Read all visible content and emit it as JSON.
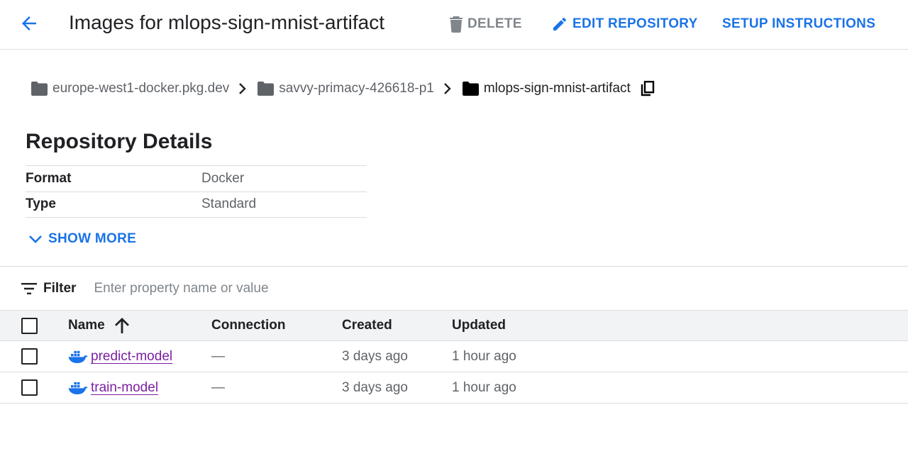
{
  "header": {
    "title": "Images for mlops-sign-mnist-artifact",
    "delete_label": "DELETE",
    "edit_label": "EDIT REPOSITORY",
    "setup_label": "SETUP INSTRUCTIONS"
  },
  "breadcrumb": {
    "items": [
      "europe-west1-docker.pkg.dev",
      "savvy-primacy-426618-p1",
      "mlops-sign-mnist-artifact"
    ]
  },
  "details": {
    "title": "Repository Details",
    "rows": [
      {
        "key": "Format",
        "value": "Docker"
      },
      {
        "key": "Type",
        "value": "Standard"
      }
    ],
    "show_more_label": "SHOW MORE"
  },
  "filter": {
    "label": "Filter",
    "placeholder": "Enter property name or value"
  },
  "table": {
    "columns": [
      "Name",
      "Connection",
      "Created",
      "Updated"
    ],
    "sort_column": "Name",
    "sort_direction": "ascending",
    "rows": [
      {
        "name": "predict-model",
        "connection": "—",
        "created": "3 days ago",
        "updated": "1 hour ago"
      },
      {
        "name": "train-model",
        "connection": "—",
        "created": "3 days ago",
        "updated": "1 hour ago"
      }
    ]
  },
  "icons": [
    "back-arrow-icon",
    "trash-icon",
    "pencil-icon",
    "folder-icon",
    "chevron-right-icon",
    "copy-icon",
    "chevron-down-icon",
    "filter-icon",
    "arrow-up-icon",
    "docker-icon"
  ],
  "colors": {
    "accent": "#1a73e8",
    "link_visited": "#7b1fa2",
    "muted": "#80868b",
    "header_bg": "#f1f3f4"
  }
}
